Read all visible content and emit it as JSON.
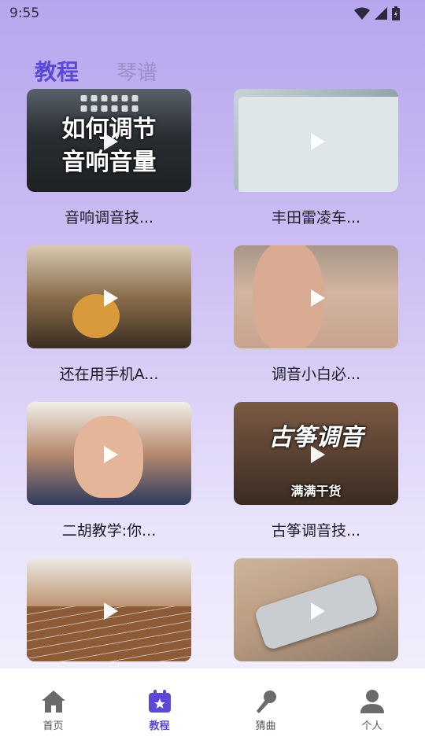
{
  "status_bar": {
    "time": "9:55"
  },
  "tabs": [
    {
      "label": "教程",
      "active": true
    },
    {
      "label": "琴谱",
      "active": false
    }
  ],
  "cards": [
    {
      "title": "音响调音技...",
      "overlay_line1": "如何调节",
      "overlay_line2": "音响音量"
    },
    {
      "title": "丰田雷凌车..."
    },
    {
      "title": "还在用手机A..."
    },
    {
      "title": "调音小白必..."
    },
    {
      "title": "二胡教学:你..."
    },
    {
      "title": "古筝调音技...",
      "overlay_line1": "古筝调音",
      "overlay_line2": "满满干货"
    },
    {
      "title": ""
    },
    {
      "title": ""
    }
  ],
  "bottom_nav": [
    {
      "label": "首页",
      "icon": "home-icon",
      "active": false
    },
    {
      "label": "教程",
      "icon": "calendar-star-icon",
      "active": true
    },
    {
      "label": "猜曲",
      "icon": "microphone-icon",
      "active": false
    },
    {
      "label": "个人",
      "icon": "person-icon",
      "active": false
    }
  ],
  "colors": {
    "accent": "#5b49d6",
    "inactive_tab": "#9b90c8",
    "nav_inactive": "#6b6b6b"
  }
}
